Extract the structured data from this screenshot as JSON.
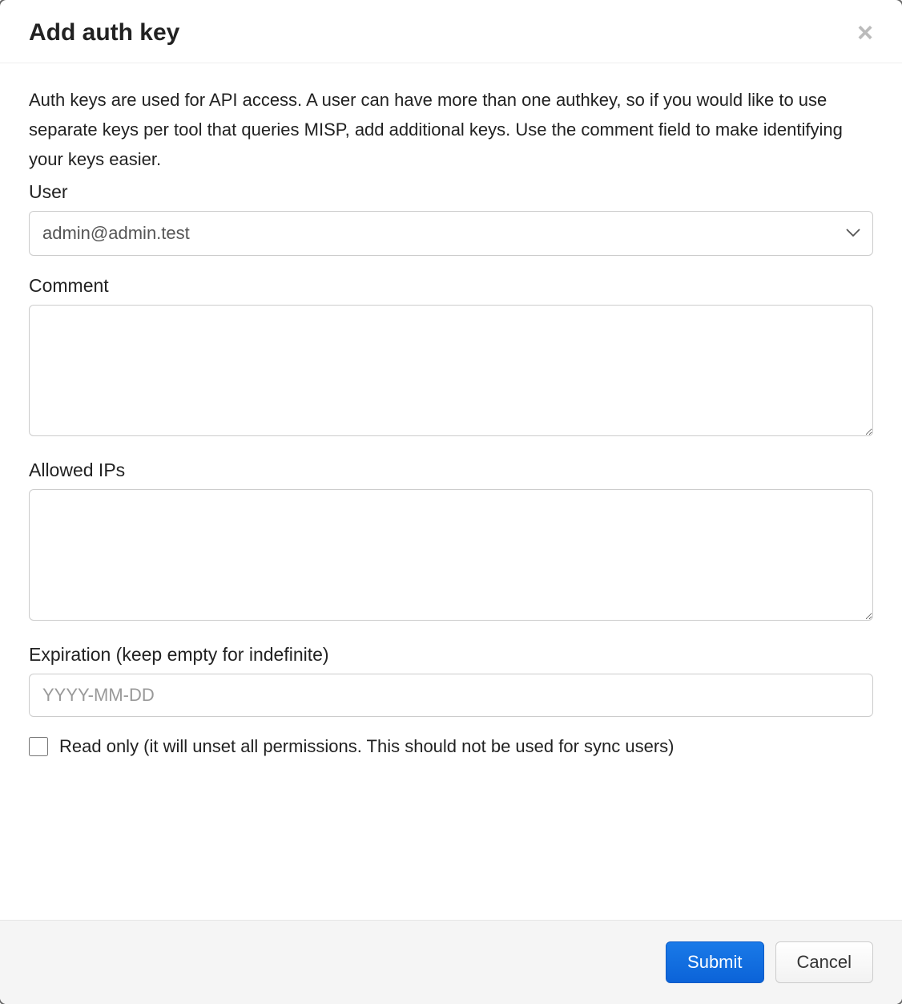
{
  "modal": {
    "title": "Add auth key",
    "description": "Auth keys are used for API access. A user can have more than one authkey, so if you would like to use separate keys per tool that queries MISP, add additional keys. Use the comment field to make identifying your keys easier.",
    "fields": {
      "user": {
        "label": "User",
        "value": "admin@admin.test"
      },
      "comment": {
        "label": "Comment",
        "value": ""
      },
      "allowed_ips": {
        "label": "Allowed IPs",
        "value": ""
      },
      "expiration": {
        "label": "Expiration (keep empty for indefinite)",
        "placeholder": "YYYY-MM-DD",
        "value": ""
      },
      "read_only": {
        "label": "Read only (it will unset all permissions. This should not be used for sync users)",
        "checked": false
      }
    },
    "footer": {
      "submit_label": "Submit",
      "cancel_label": "Cancel"
    }
  }
}
